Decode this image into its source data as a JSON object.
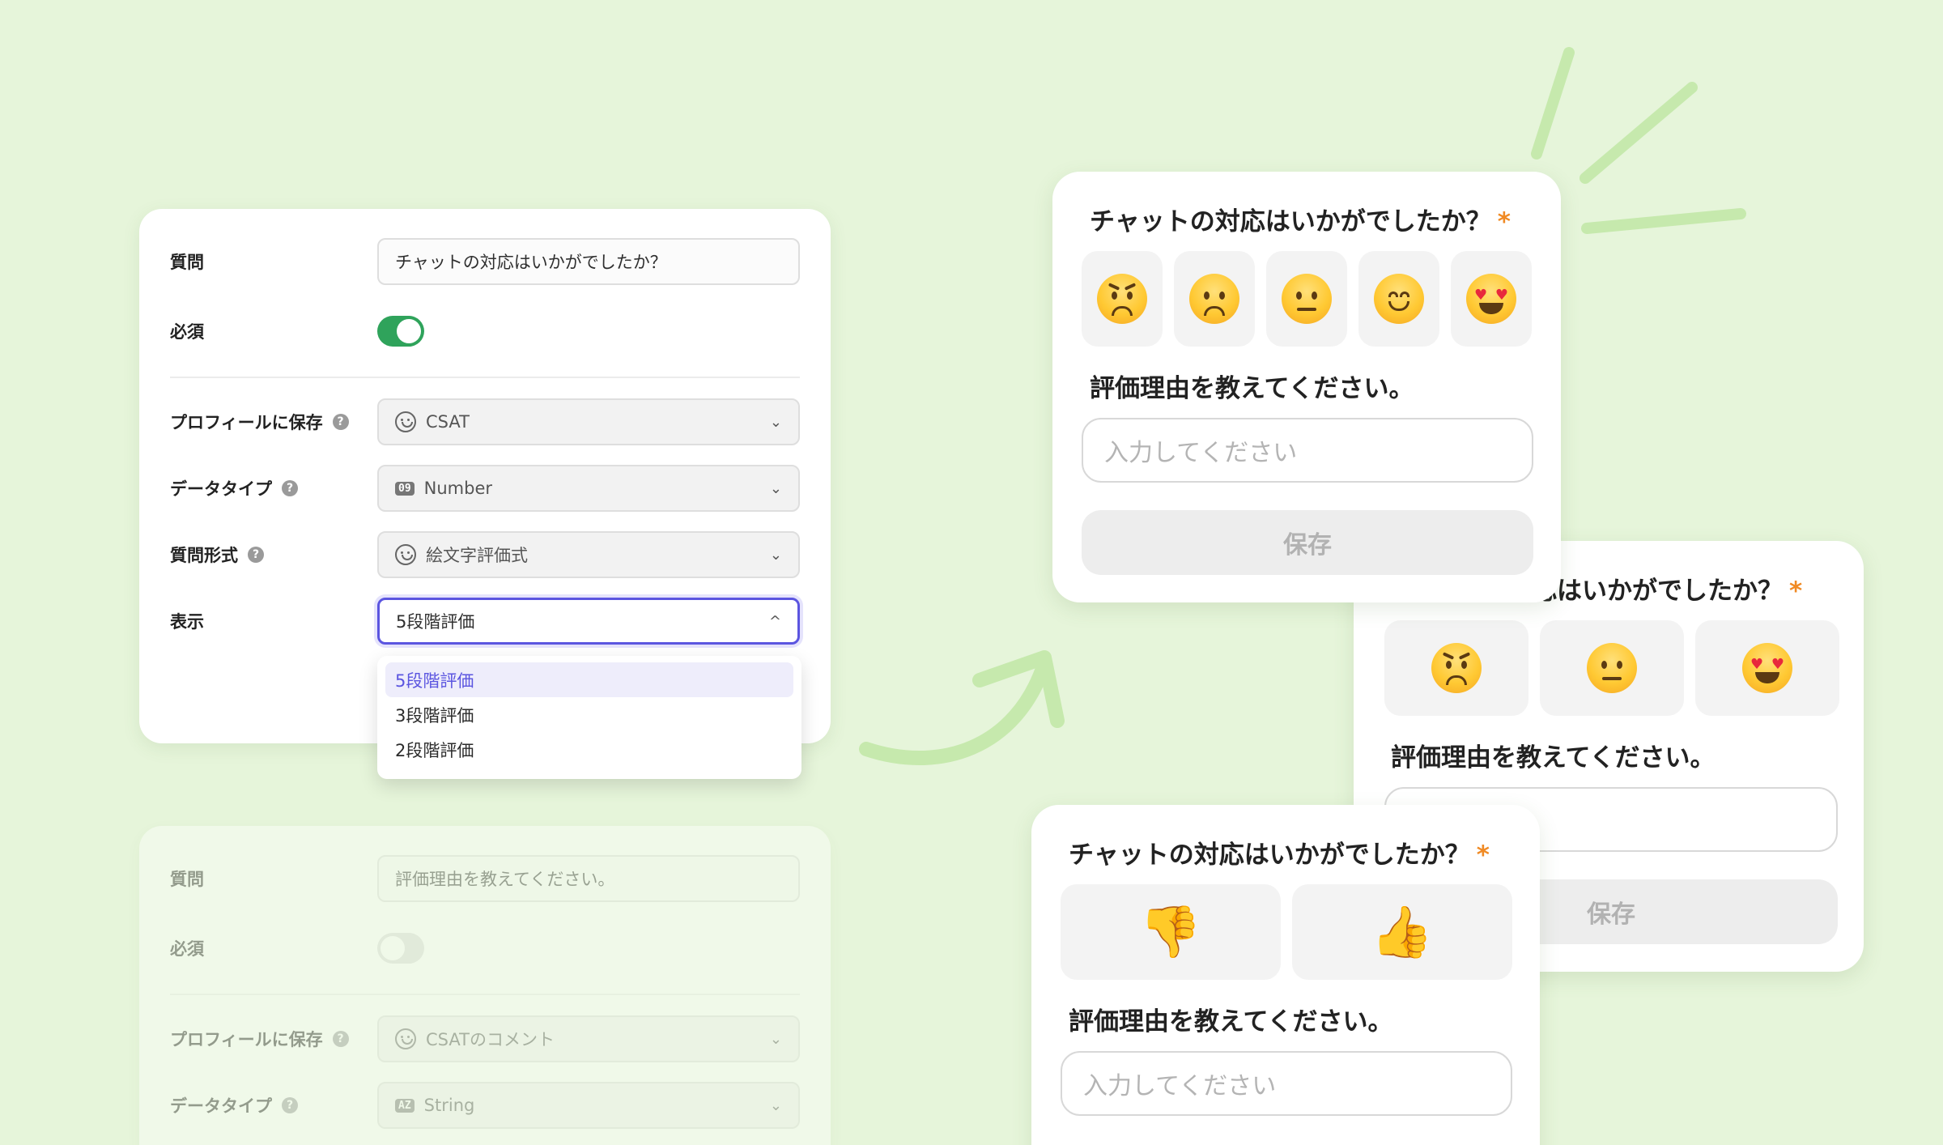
{
  "panel_top": {
    "question_label": "質問",
    "question_value": "チャットの対応はいかがでしたか？",
    "required_label": "必須",
    "required_on": true,
    "profile_label": "プロフィールに保存",
    "profile_value": "CSAT",
    "datatype_label": "データタイプ",
    "datatype_icon": "09",
    "datatype_value": "Number",
    "format_label": "質問形式",
    "format_value": "絵文字評価式",
    "display_label": "表示",
    "display_value": "5段階評価",
    "help_glyph": "?",
    "chevron_down": "⌄",
    "chevron_up": "^",
    "dropdown_options": [
      "5段階評価",
      "3段階評価",
      "2段階評価"
    ]
  },
  "panel_bottom": {
    "question_label": "質問",
    "question_value": "評価理由を教えてください。",
    "required_label": "必須",
    "required_on": false,
    "profile_label": "プロフィールに保存",
    "profile_value": "CSATのコメント",
    "datatype_label": "データタイプ",
    "datatype_icon": "AZ",
    "datatype_value": "String"
  },
  "card_five": {
    "question": "チャットの対応はいかがでしたか？",
    "required_mark": "*",
    "emojis": [
      "angry-face",
      "frowning-face",
      "neutral-face",
      "smiling-face",
      "heart-eyes-face"
    ],
    "reason_question": "評価理由を教えてください。",
    "input_placeholder": "入力してください",
    "save_label": "保存"
  },
  "card_three": {
    "question_partial": "応はいかがでしたか？",
    "required_mark": "*",
    "emojis": [
      "angry-face",
      "neutral-face",
      "heart-eyes-face"
    ],
    "reason_question": "評価理由を教えてください。",
    "save_label": "保存"
  },
  "card_two": {
    "question": "チャットの対応はいかがでしたか？",
    "required_mark": "*",
    "emojis": [
      "thumbs-down",
      "thumbs-up"
    ],
    "reason_question": "評価理由を教えてください。",
    "input_placeholder": "入力してください"
  },
  "colors": {
    "background": "#e6f5da",
    "toggle_on": "#2fa35b",
    "focus": "#5b55e0",
    "required_asterisk": "#f08a24",
    "decoration": "#c6e9ad"
  }
}
